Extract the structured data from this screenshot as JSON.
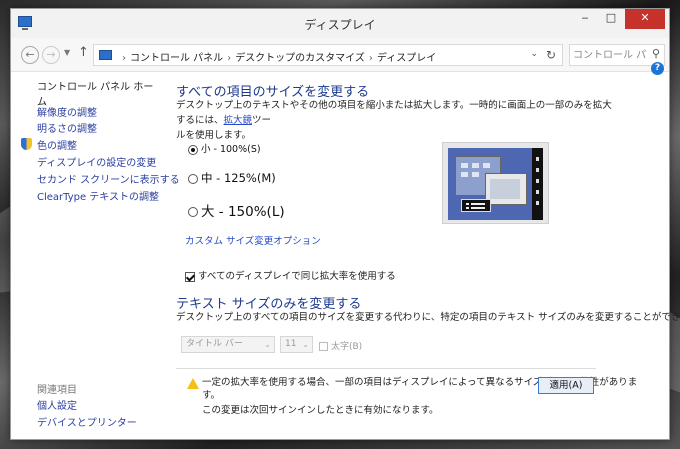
{
  "window": {
    "title": "ディスプレイ",
    "controls": {
      "minimize": "‒",
      "maximize": "□",
      "close": "✕"
    }
  },
  "addressbar": {
    "breadcrumbs": [
      "コントロール パネル",
      "デスクトップのカスタマイズ",
      "ディスプレイ"
    ],
    "search_placeholder": "コントロール パ..."
  },
  "sidebar": {
    "home": "コントロール パネル ホーム",
    "links": [
      "解像度の調整",
      "明るさの調整",
      "色の調整",
      "ディスプレイの設定の変更",
      "セカンド スクリーンに表示する",
      "ClearType テキストの調整"
    ],
    "related_heading": "関連項目",
    "related_links": [
      "個人設定",
      "デバイスとプリンター"
    ]
  },
  "main": {
    "section1_title": "すべての項目のサイズを変更する",
    "section1_desc_line1_pre": "デスクトップ上のテキストやその他の項目を縮小または拡大します。一時的に画面上の一部のみを拡大するには、",
    "section1_desc_link": "拡大鏡",
    "section1_desc_line1_post": "ツー",
    "section1_desc_line2": "ルを使用します。",
    "options": [
      {
        "label": "小 - 100%(S)",
        "selected": true
      },
      {
        "label": "中 - 125%(M)",
        "selected": false
      },
      {
        "label": "大 - 150%(L)",
        "selected": false
      }
    ],
    "custom_link": "カスタム サイズ変更オプション",
    "same_scale_label": "すべてのディスプレイで同じ拡大率を使用する",
    "same_scale_checked": true,
    "section2_title": "テキスト サイズのみを変更する",
    "section2_desc": "デスクトップ上のすべての項目のサイズを変更する代わりに、特定の項目のテキスト サイズのみを変更することができます。",
    "item_select_value": "タイトル バー",
    "size_select_value": "11",
    "bold_label": "太字(B)",
    "warning_line1": "一定の拡大率を使用する場合、一部の項目はディスプレイによって異なるサイズになる可能性がありま",
    "warning_line2": "す。",
    "warning_line3": "この変更は次回サインインしたときに有効になります。",
    "apply_button": "適用(A)"
  },
  "colors": {
    "link": "#2a4cc7",
    "heading": "#1c3a8d",
    "close_button": "#c7312b",
    "preview_screen": "#4d67b3"
  }
}
